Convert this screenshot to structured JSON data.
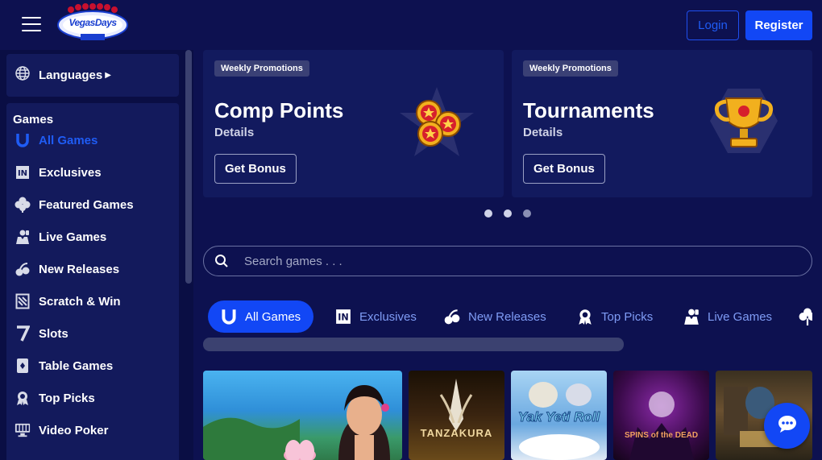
{
  "header": {
    "logo_text": "VegasDays",
    "login_label": "Login",
    "register_label": "Register"
  },
  "sidebar": {
    "languages_label": "Languages",
    "games_title": "Games",
    "items": [
      {
        "label": "All Games",
        "icon": "horseshoe-icon",
        "active": true
      },
      {
        "label": "Exclusives",
        "icon": "in-badge-icon",
        "active": false
      },
      {
        "label": "Featured Games",
        "icon": "clover-icon",
        "active": false
      },
      {
        "label": "Live Games",
        "icon": "dealer-icon",
        "active": false
      },
      {
        "label": "New Releases",
        "icon": "cherries-icon",
        "active": false
      },
      {
        "label": "Scratch & Win",
        "icon": "scratch-card-icon",
        "active": false
      },
      {
        "label": "Slots",
        "icon": "seven-icon",
        "active": false
      },
      {
        "label": "Table Games",
        "icon": "playing-card-icon",
        "active": false
      },
      {
        "label": "Top Picks",
        "icon": "award-ribbon-icon",
        "active": false
      },
      {
        "label": "Video Poker",
        "icon": "video-poker-icon",
        "active": false
      }
    ]
  },
  "promos": [
    {
      "tag": "Weekly Promotions",
      "title": "Comp Points",
      "subtitle": "Details",
      "button": "Get Bonus",
      "art": "coins-art"
    },
    {
      "tag": "Weekly Promotions",
      "title": "Tournaments",
      "subtitle": "Details",
      "button": "Get Bonus",
      "art": "trophy-art"
    }
  ],
  "carousel": {
    "active_dot": 0,
    "dot_count": 3
  },
  "search": {
    "placeholder": "Search games . . ."
  },
  "tabs": [
    {
      "label": "All Games",
      "icon": "horseshoe-icon",
      "active": true
    },
    {
      "label": "Exclusives",
      "icon": "in-badge-icon",
      "active": false
    },
    {
      "label": "New Releases",
      "icon": "cherries-icon",
      "active": false
    },
    {
      "label": "Top Picks",
      "icon": "award-ribbon-icon",
      "active": false
    },
    {
      "label": "Live Games",
      "icon": "dealer-icon",
      "active": false
    }
  ],
  "games": [
    {
      "title": ""
    },
    {
      "title": "TANZAKURA"
    },
    {
      "title": "Yak Yeti Roll"
    },
    {
      "title": "SPINS of the DEAD"
    },
    {
      "title": ""
    }
  ],
  "colors": {
    "background": "#0d1150",
    "sidebar": "#0a0e44",
    "accent": "#1247f5",
    "card": "#121a5e"
  }
}
